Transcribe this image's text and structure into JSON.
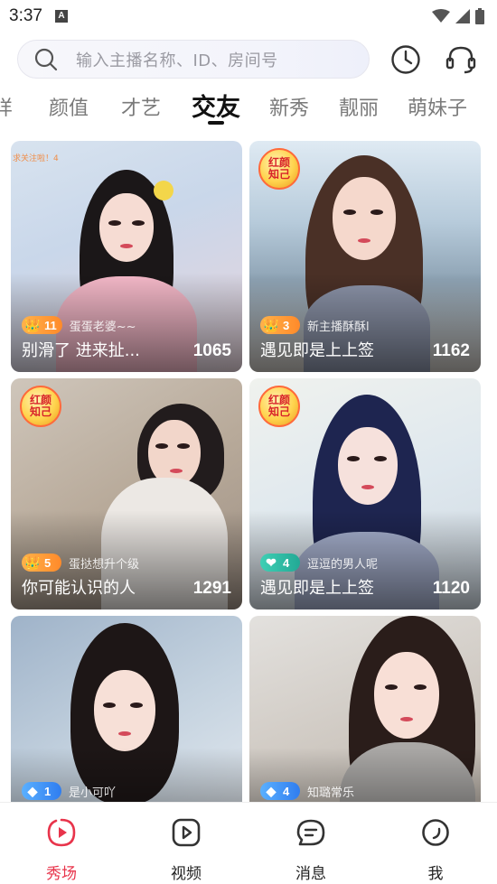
{
  "status_bar": {
    "time": "3:37",
    "indicator": "A"
  },
  "search": {
    "placeholder": "输入主播名称、ID、房间号"
  },
  "header_icons": {
    "history": "clock-icon",
    "service": "headset-icon"
  },
  "tabs": {
    "items": [
      {
        "label": "样"
      },
      {
        "label": "颜值"
      },
      {
        "label": "才艺"
      },
      {
        "label": "交友",
        "active": true
      },
      {
        "label": "新秀"
      },
      {
        "label": "靓丽"
      },
      {
        "label": "萌妹子"
      }
    ]
  },
  "cards": [
    {
      "title": "别滑了 进来扯...",
      "count": "1065",
      "level": "11",
      "level_type": "crown",
      "host": "蛋蛋老婆~~",
      "corner": "",
      "overlay": "求关注啦！4"
    },
    {
      "title": "遇见即是上上签",
      "count": "1162",
      "level": "3",
      "level_type": "crown",
      "host": "新主播酥酥l",
      "corner": "红颜知己",
      "overlay": ""
    },
    {
      "title": "你可能认识的人",
      "count": "1291",
      "level": "5",
      "level_type": "crown",
      "host": "蛋挞想升个级",
      "corner": "红颜知己",
      "overlay": ""
    },
    {
      "title": "遇见即是上上签",
      "count": "1120",
      "level": "4",
      "level_type": "heart",
      "host": "逗逗的男人呢",
      "corner": "红颜知己",
      "overlay": ""
    },
    {
      "title": "",
      "count": "",
      "level": "1",
      "level_type": "gem",
      "host": "是小可吖",
      "corner": "",
      "overlay": ""
    },
    {
      "title": "",
      "count": "",
      "level": "4",
      "level_type": "gem",
      "host": "知璐常乐",
      "corner": "",
      "overlay": ""
    }
  ],
  "bottom_nav": {
    "items": [
      {
        "label": "秀场",
        "icon": "play-icon",
        "active": true
      },
      {
        "label": "视频",
        "icon": "video-icon"
      },
      {
        "label": "消息",
        "icon": "message-icon"
      },
      {
        "label": "我",
        "icon": "profile-icon"
      }
    ]
  },
  "colors": {
    "accent": "#e8344b",
    "crown_badge": "#ff9a3a",
    "heart_badge": "#2fbfa7",
    "gem_badge": "#3d8ff5"
  }
}
